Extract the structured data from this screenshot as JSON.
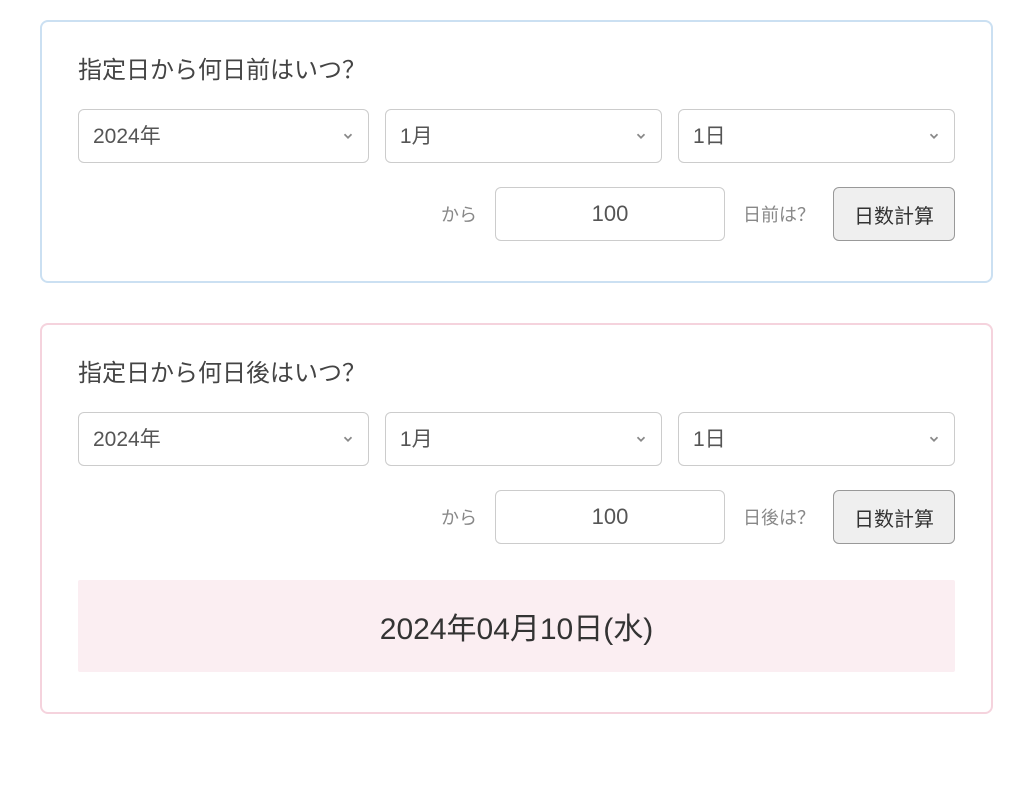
{
  "before_panel": {
    "title": "指定日から何日前はいつ？",
    "year": "2024年",
    "month": "1月",
    "day": "1日",
    "from_label": "から",
    "days_value": "100",
    "suffix_label": "日前は？",
    "button_label": "日数計算"
  },
  "after_panel": {
    "title": "指定日から何日後はいつ？",
    "year": "2024年",
    "month": "1月",
    "day": "1日",
    "from_label": "から",
    "days_value": "100",
    "suffix_label": "日後は？",
    "button_label": "日数計算",
    "result": "2024年04月10日(水)"
  }
}
